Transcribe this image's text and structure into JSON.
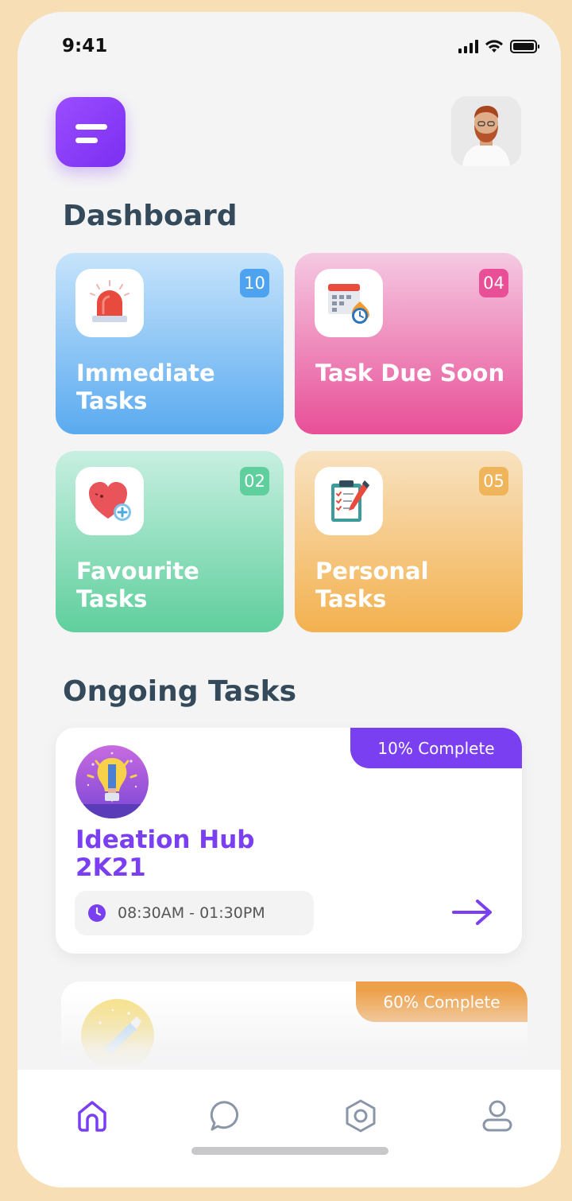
{
  "status_bar": {
    "time": "9:41"
  },
  "header": {
    "menu_icon": "menu-icon",
    "avatar": "user-avatar"
  },
  "dashboard": {
    "title": "Dashboard",
    "cards": [
      {
        "label": "Immediate Tasks",
        "count": "10",
        "icon": "siren-icon",
        "color": "#4da3ef"
      },
      {
        "label": "Task Due Soon",
        "count": "04",
        "icon": "calendar-clock-icon",
        "color": "#e84f97"
      },
      {
        "label": "Favourite Tasks",
        "count": "02",
        "icon": "heart-plus-icon",
        "color": "#5fcf9d"
      },
      {
        "label": "Personal Tasks",
        "count": "05",
        "icon": "clipboard-pen-icon",
        "color": "#f0b55a"
      }
    ]
  },
  "ongoing": {
    "title": "Ongoing Tasks",
    "tasks": [
      {
        "title": "Ideation Hub 2K21",
        "progress_label": "10% Complete",
        "progress": 0.1,
        "time": "08:30AM - 01:30PM",
        "icon": "lightbulb-pencil-icon",
        "accent": "#7b3ff2"
      },
      {
        "progress_label": "60% Complete",
        "progress": 0.6,
        "icon": "lightbulb-pencil-icon",
        "accent": "#eda04a"
      }
    ]
  },
  "bottom_nav": {
    "items": [
      {
        "icon": "home-icon",
        "active": true
      },
      {
        "icon": "chat-icon",
        "active": false
      },
      {
        "icon": "settings-hex-icon",
        "active": false
      },
      {
        "icon": "profile-icon",
        "active": false
      }
    ]
  }
}
